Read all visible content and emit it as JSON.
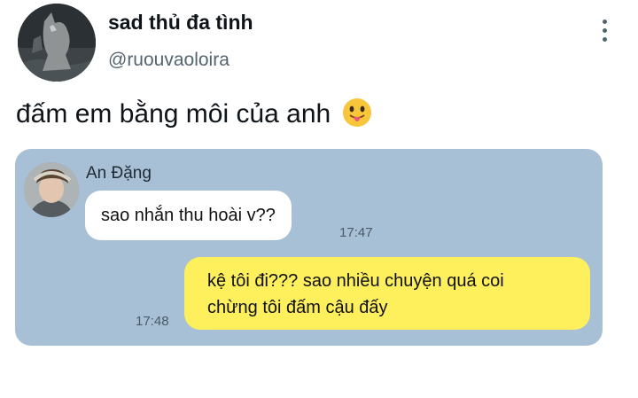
{
  "tweet": {
    "display_name": "sad thủ đa tình",
    "handle": "@ruouvaoloira",
    "text": "đấm em bằng môi của anh",
    "emoji_icon": "tongue-out-face-emoji"
  },
  "chat_screenshot": {
    "contact_name": "An Đặng",
    "incoming": {
      "text": "sao nhắn thu hoài v??",
      "time": "17:47"
    },
    "outgoing": {
      "lines": [
        "kệ tôi đi??? sao nhiều chuyện quá coi",
        "chừng tôi đấm cậu đấy"
      ],
      "time": "17:48"
    }
  },
  "colors": {
    "chat_background": "#a8c0d6",
    "incoming_bubble": "#ffffff",
    "outgoing_bubble": "#fdf05c",
    "handle_text": "#536471"
  }
}
